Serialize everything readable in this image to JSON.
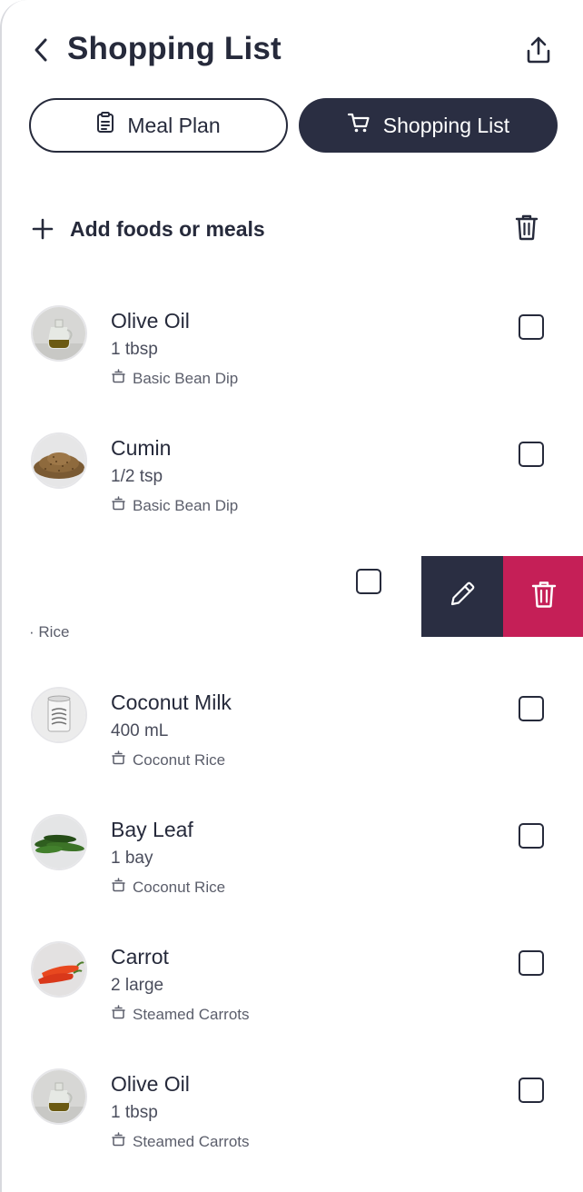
{
  "header": {
    "title": "Shopping List"
  },
  "tabs": {
    "meal_plan_label": "Meal Plan",
    "shopping_list_label": "Shopping List",
    "active": "Shopping List"
  },
  "add_row": {
    "label": "Add foods or meals"
  },
  "items": [
    {
      "name": "Olive Oil",
      "quantity": "1 tbsp",
      "meal": "Basic Bean Dip",
      "image": "olive-oil",
      "checked": false
    },
    {
      "name": "Cumin",
      "quantity": "1/2 tsp",
      "meal": "Basic Bean Dip",
      "image": "cumin",
      "checked": false
    },
    {
      "name": "Coconut Milk",
      "quantity": "400 mL",
      "meal": "Coconut Rice",
      "image": "coconut-milk",
      "checked": false
    },
    {
      "name": "Bay Leaf",
      "quantity": "1 bay",
      "meal": "Coconut Rice",
      "image": "bay-leaf",
      "checked": false
    },
    {
      "name": "Carrot",
      "quantity": "2 large",
      "meal": "Steamed Carrots",
      "image": "carrot",
      "checked": false
    },
    {
      "name": "Olive Oil",
      "quantity": "1 tbsp",
      "meal": "Steamed Carrots",
      "image": "olive-oil",
      "checked": false
    }
  ],
  "swiped_item": {
    "meal_fragment": "· Rice",
    "checked": false,
    "actions": [
      "edit",
      "delete"
    ]
  },
  "colors": {
    "primary": "#2a2e42",
    "danger": "#c51f57",
    "text": "#262a3b"
  },
  "icons": {
    "back": "chevron-left-icon",
    "share": "share-icon",
    "meal_plan": "clipboard-icon",
    "shopping_list": "cart-icon",
    "add": "plus-icon",
    "clear": "trash-icon",
    "meal_tag": "pot-icon",
    "edit": "pencil-icon",
    "delete": "trash-icon"
  }
}
